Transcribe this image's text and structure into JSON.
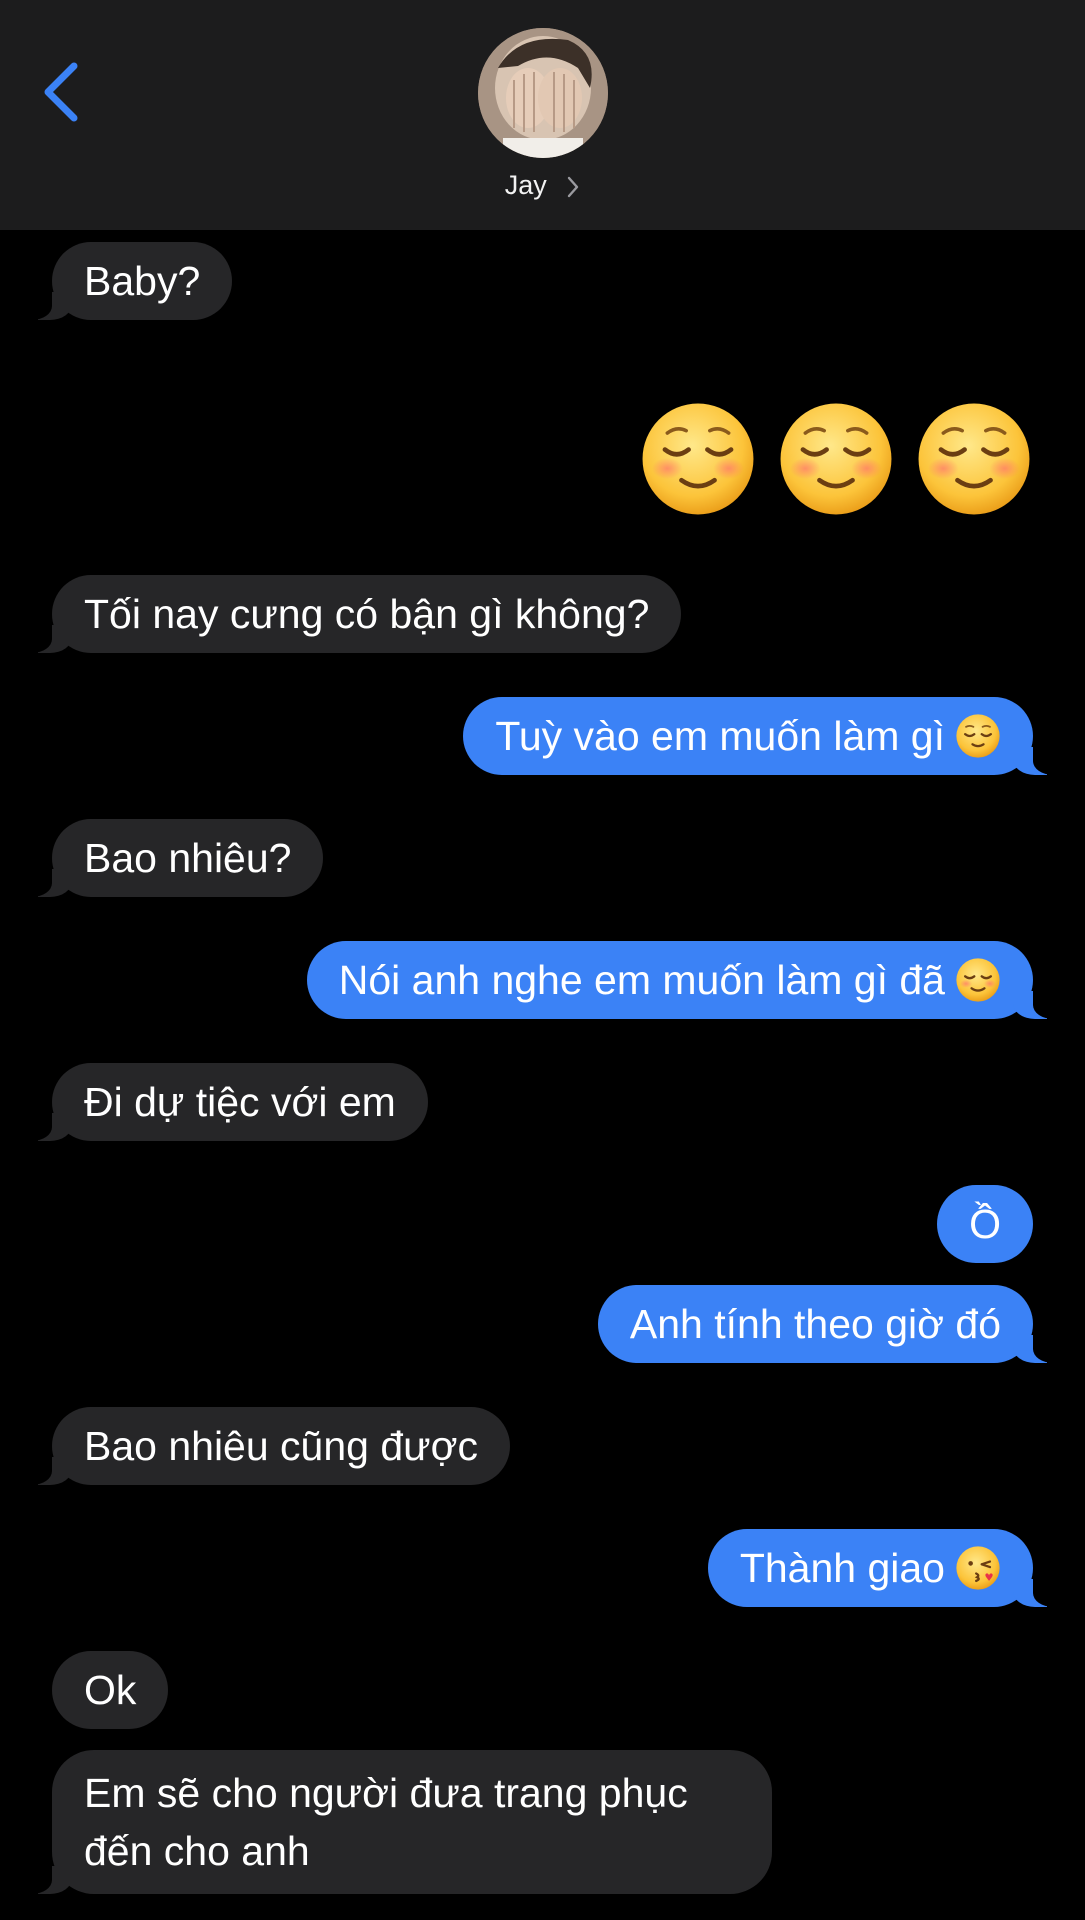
{
  "header": {
    "contact_name": "Jay"
  },
  "messages": [
    {
      "id": "m1",
      "direction": "incoming",
      "text": "Baby?"
    },
    {
      "id": "m2",
      "direction": "outgoing",
      "text": "☺️☺️☺️",
      "emoji_only": true
    },
    {
      "id": "m3",
      "direction": "incoming",
      "text": "Tối nay cưng có bận gì không?"
    },
    {
      "id": "m4",
      "direction": "outgoing",
      "text": "Tuỳ vào em muốn làm gì",
      "emoji": "relieved-face"
    },
    {
      "id": "m5",
      "direction": "incoming",
      "text": "Bao nhiêu?"
    },
    {
      "id": "m6",
      "direction": "outgoing",
      "text": "Nói anh nghe em muốn làm gì đã",
      "emoji": "smiling-face"
    },
    {
      "id": "m7",
      "direction": "incoming",
      "text": "Đi dự tiệc với em"
    },
    {
      "id": "m8",
      "direction": "outgoing",
      "text": "Ồ"
    },
    {
      "id": "m9",
      "direction": "outgoing",
      "text": "Anh tính theo giờ đó"
    },
    {
      "id": "m10",
      "direction": "incoming",
      "text": "Bao nhiêu cũng được"
    },
    {
      "id": "m11",
      "direction": "outgoing",
      "text": "Thành giao",
      "emoji": "kissing-face"
    },
    {
      "id": "m12",
      "direction": "incoming",
      "text": "Ok"
    },
    {
      "id": "m13",
      "direction": "incoming",
      "text": "Em sẽ cho người đưa trang phục đến cho anh"
    }
  ],
  "colors": {
    "header_bg": "#1c1c1d",
    "incoming_bubble": "#262628",
    "outgoing_bubble": "#3b82f6",
    "accent": "#3b82f6",
    "background": "#000000"
  },
  "icons": [
    "chevron-left-icon",
    "chevron-right-icon",
    "smiling-face-icon",
    "relieved-face-icon",
    "kissing-face-icon"
  ]
}
